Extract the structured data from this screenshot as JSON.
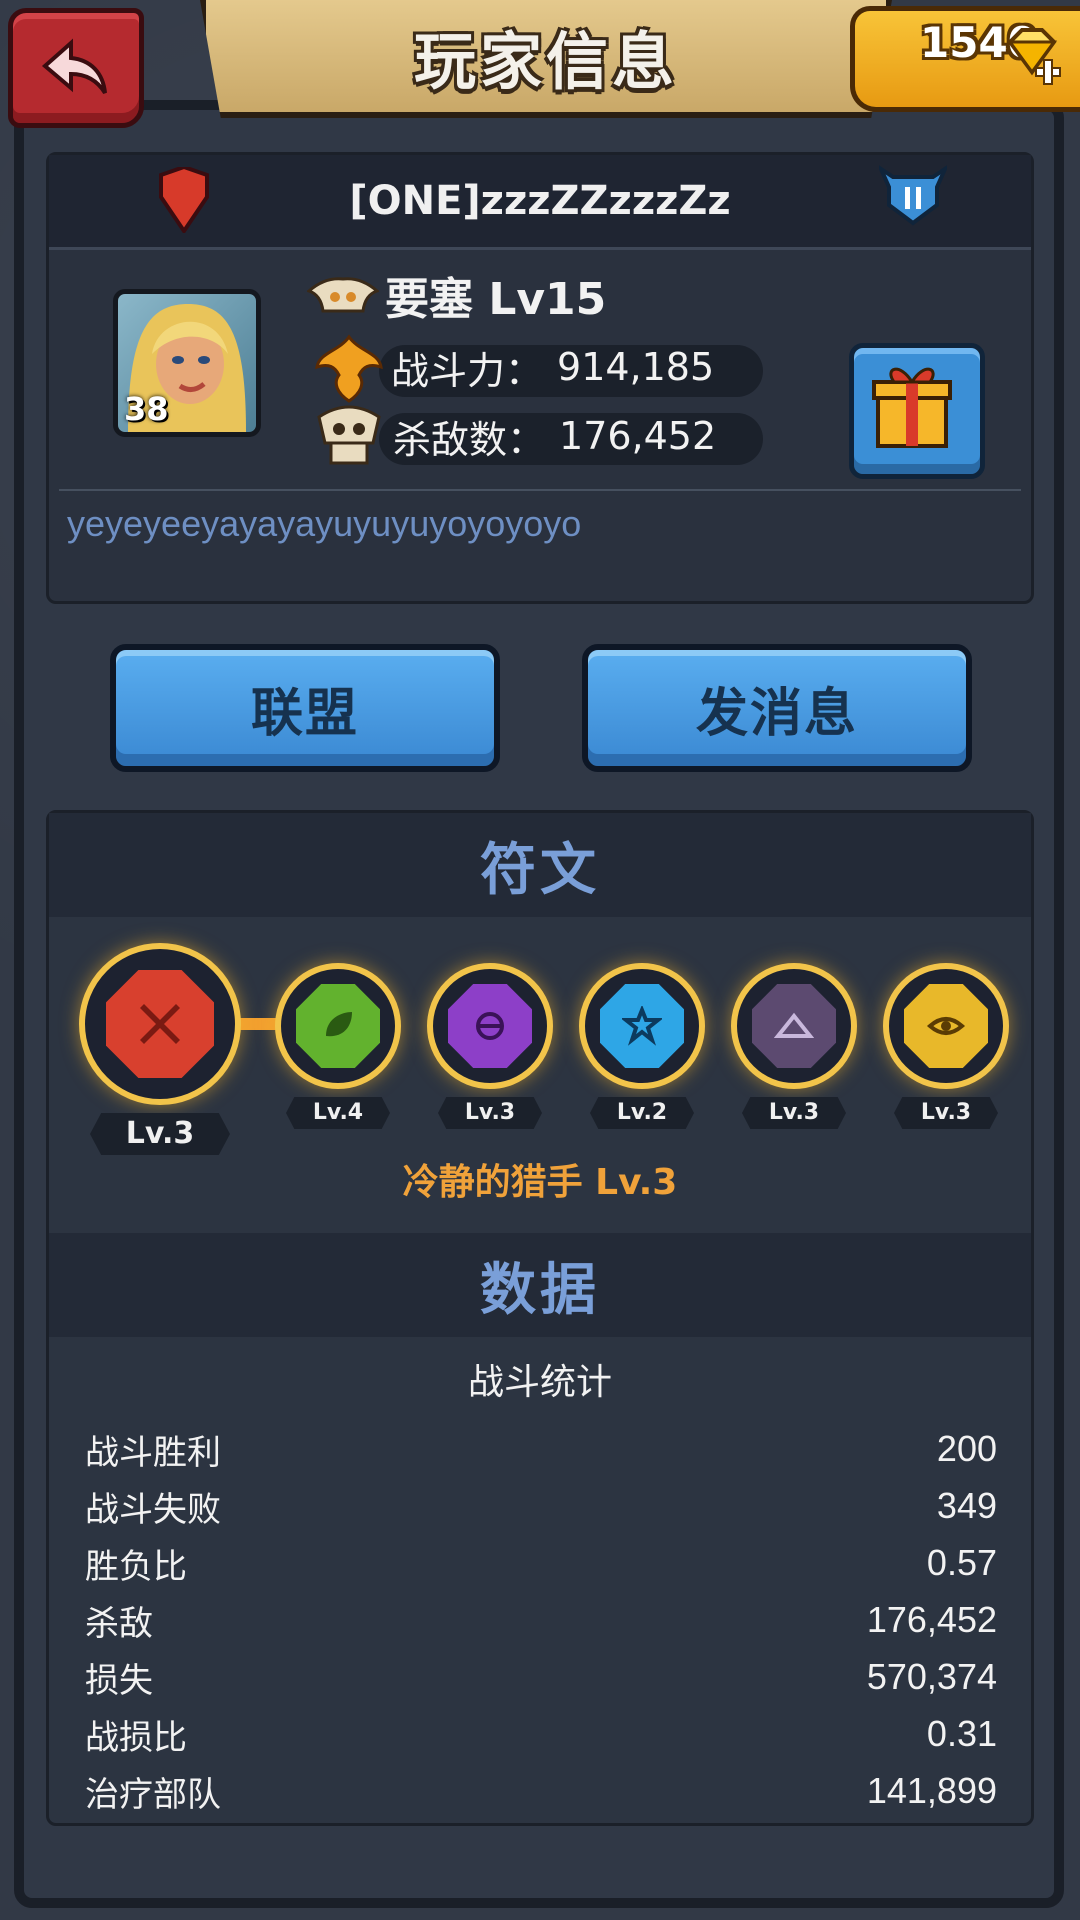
{
  "header": {
    "title": "玩家信息",
    "gems": "1540"
  },
  "player": {
    "name": "[ONE]zzzZZzzzZz",
    "avatar_level": "38",
    "fortress": "要塞 Lv15",
    "power_label": "战斗力：",
    "power_value": "914,185",
    "kills_label": "杀敌数：",
    "kills_value": "176,452",
    "motto": "yeyeyeeyayayayuyuyuyoyoyoyo"
  },
  "actions": {
    "alliance": "联盟",
    "message": "发消息"
  },
  "runes": {
    "section_title": "符文",
    "items": [
      {
        "level": "Lv.3",
        "icon": "red-cross-rune-icon"
      },
      {
        "level": "Lv.4",
        "icon": "green-leaf-rune-icon"
      },
      {
        "level": "Lv.3",
        "icon": "purple-rune-icon"
      },
      {
        "level": "Lv.2",
        "icon": "blue-star-rune-icon"
      },
      {
        "level": "Lv.3",
        "icon": "dark-mountain-rune-icon"
      },
      {
        "level": "Lv.3",
        "icon": "yellow-eye-rune-icon"
      }
    ],
    "active_title": "冷静的猎手 Lv.3"
  },
  "data": {
    "section_title": "数据",
    "subtitle": "战斗统计",
    "rows": [
      {
        "label": "战斗胜利",
        "value": "200"
      },
      {
        "label": "战斗失败",
        "value": "349"
      },
      {
        "label": "胜负比",
        "value": "0.57"
      },
      {
        "label": "杀敌",
        "value": "176,452"
      },
      {
        "label": "损失",
        "value": "570,374"
      },
      {
        "label": "战损比",
        "value": "0.31"
      },
      {
        "label": "治疗部队",
        "value": "141,899"
      }
    ]
  },
  "colors": {
    "accent_blue": "#3a88d2",
    "rune_gold": "#f2c44a",
    "title_orange": "#f0a23a",
    "section_blue": "#7a9fd8"
  }
}
